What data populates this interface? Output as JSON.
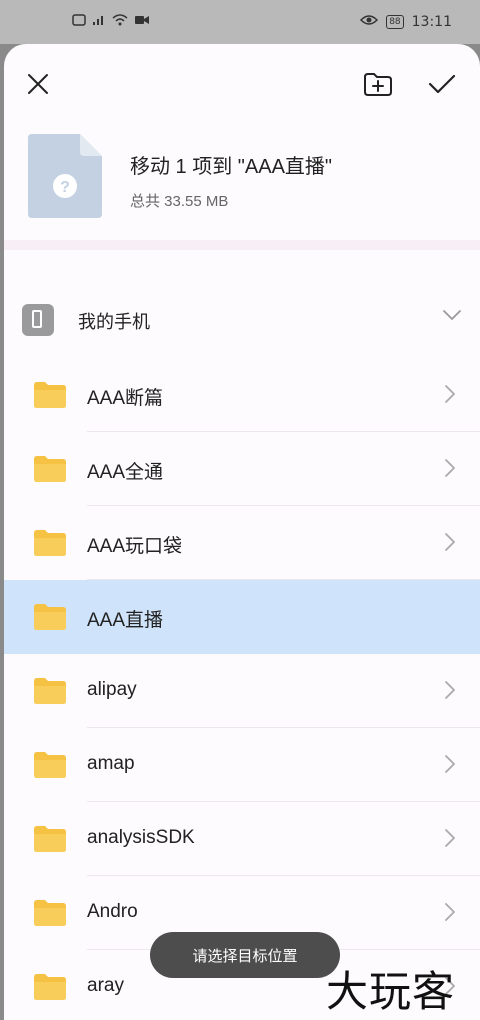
{
  "status_bar": {
    "left_icons": [
      "sim-card-icon",
      "signal-icon",
      "wifi-icon",
      "video-record-icon"
    ],
    "right_icons": [
      "eye-comfort-icon",
      "battery-icon"
    ],
    "battery_level": "88",
    "time": "13:11"
  },
  "toolbar": {
    "close_icon": "close-icon",
    "new_folder_icon": "new-folder-icon",
    "confirm_icon": "check-icon"
  },
  "file_info": {
    "icon": "unknown-file-icon",
    "title": "移动 1 项到 \"AAA直播\"",
    "subtitle": "总共 33.55 MB"
  },
  "location": {
    "label": "我的手机",
    "icon": "phone-icon"
  },
  "folders": [
    {
      "name": "AAA断篇",
      "selected": false
    },
    {
      "name": "AAA全通",
      "selected": false
    },
    {
      "name": "AAA玩口袋",
      "selected": false
    },
    {
      "name": "AAA直播",
      "selected": true
    },
    {
      "name": "alipay",
      "selected": false
    },
    {
      "name": "amap",
      "selected": false
    },
    {
      "name": "analysisSDK",
      "selected": false
    },
    {
      "name": "Andro",
      "selected": false
    },
    {
      "name": "aray",
      "selected": false
    }
  ],
  "toast": {
    "text": "请选择目标位置"
  },
  "watermark": "大玩客",
  "colors": {
    "selected_row": "#cfe3fa",
    "folder": "#f6c243",
    "toast_bg": "#4d4d4d"
  }
}
